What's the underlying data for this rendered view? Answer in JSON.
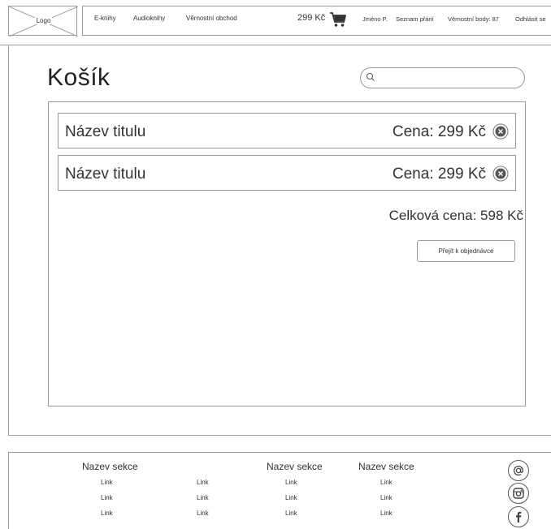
{
  "header": {
    "logo": "Logo",
    "nav": [
      "E-knihy",
      "Audioknihy",
      "Věrnostní obchod"
    ],
    "cart_price": "299 Kč",
    "user": {
      "name": "Jméno P.",
      "wishlist": "Seznam přání",
      "points": "Věrnostní body: 87",
      "logout": "Odhlásit se"
    }
  },
  "main": {
    "title": "Košík",
    "search_placeholder": "",
    "items": [
      {
        "title": "Název titulu",
        "price": "Cena: 299 Kč"
      },
      {
        "title": "Název titulu",
        "price": "Cena: 299 Kč"
      }
    ],
    "total": "Celková cena: 598 Kč",
    "order_button": "Přejít k objednávce"
  },
  "footer": {
    "sections": [
      "Nazev sekce",
      "Nazev sekce",
      "Nazev sekce"
    ],
    "link": "Link",
    "social_icons": [
      "at-icon",
      "instagram-icon",
      "facebook-icon"
    ]
  }
}
